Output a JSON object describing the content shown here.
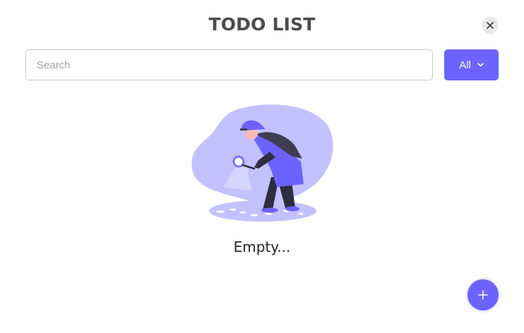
{
  "header": {
    "title": "TODO LIST",
    "close_icon": "close-icon"
  },
  "search": {
    "placeholder": "Search",
    "value": ""
  },
  "filter": {
    "selected": "All",
    "icon": "chevron-down-icon"
  },
  "empty_state": {
    "illustration": "detective-magnifying-glass-illustration",
    "text": "Empty..."
  },
  "add_button": {
    "icon": "plus-icon"
  },
  "colors": {
    "accent": "#6c63ff",
    "blob": "#c3c1ff",
    "text": "#252525"
  }
}
